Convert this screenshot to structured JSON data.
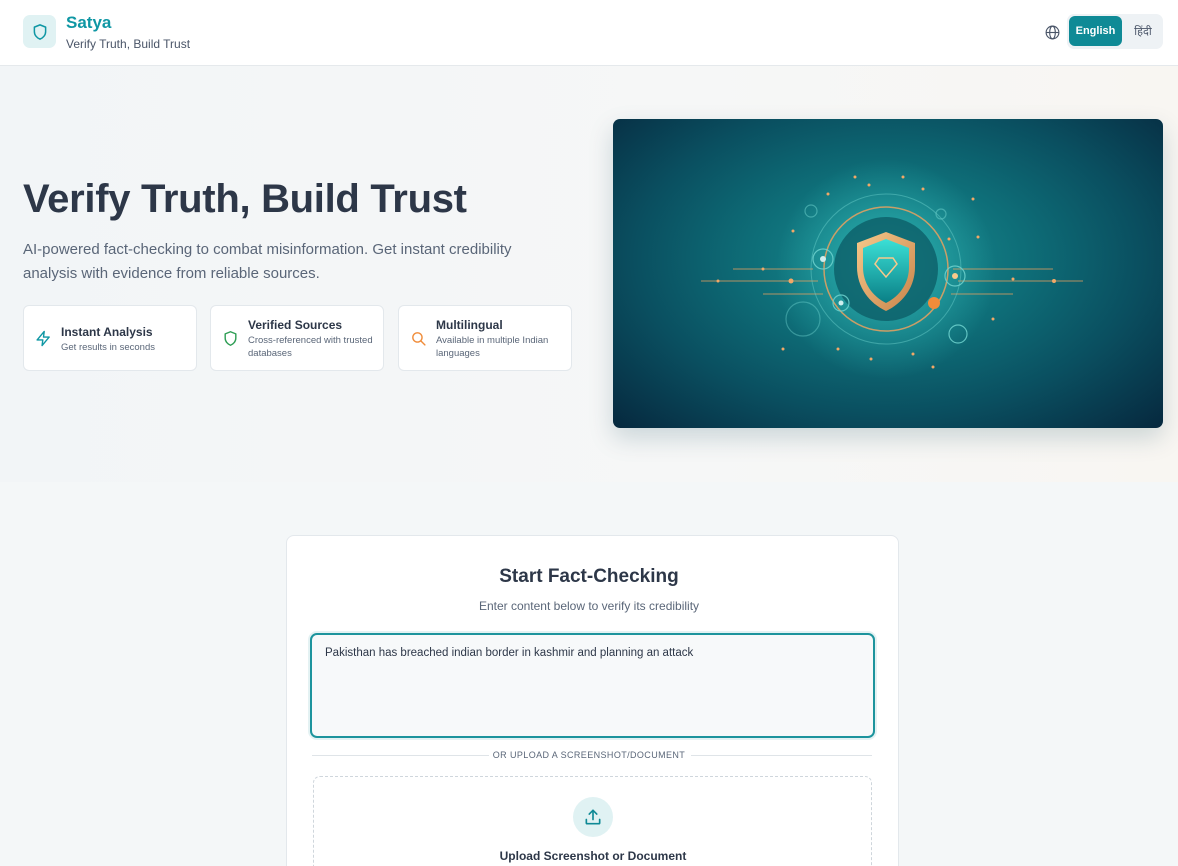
{
  "header": {
    "brand_name": "Satya",
    "brand_tagline": "Verify Truth, Build Trust",
    "logo_icon": "shield-icon",
    "language_icon": "globe-icon",
    "languages": {
      "english": "English",
      "hindi": "हिंदी"
    },
    "active_language": "English"
  },
  "hero": {
    "title": "Verify Truth, Build Trust",
    "description": "AI-powered fact-checking to combat misinformation. Get instant credibility analysis with evidence from reliable sources.",
    "features": [
      {
        "icon": "lightning-icon",
        "title": "Instant Analysis",
        "description": "Get results in seconds"
      },
      {
        "icon": "shield-icon",
        "title": "Verified Sources",
        "description": "Cross-referenced with trusted databases"
      },
      {
        "icon": "search-icon",
        "title": "Multilingual",
        "description": "Available in multiple Indian languages"
      }
    ],
    "image_icon": "shield-network-illustration"
  },
  "fact_check": {
    "title": "Start Fact-Checking",
    "subtitle": "Enter content below to verify its credibility",
    "input_value": "Pakisthan has breached indian border in kashmir and planning an attack",
    "divider_text": "OR UPLOAD A SCREENSHOT/DOCUMENT",
    "upload_icon": "upload-icon",
    "upload_label": "Upload Screenshot or Document"
  },
  "colors": {
    "brand": "#0f97a4",
    "accent_button": "#0f8a96",
    "input_border": "#1d949d",
    "lightning": "#0f97a4",
    "shield_feature": "#2f9e55",
    "search_feature": "#f08c3a"
  }
}
